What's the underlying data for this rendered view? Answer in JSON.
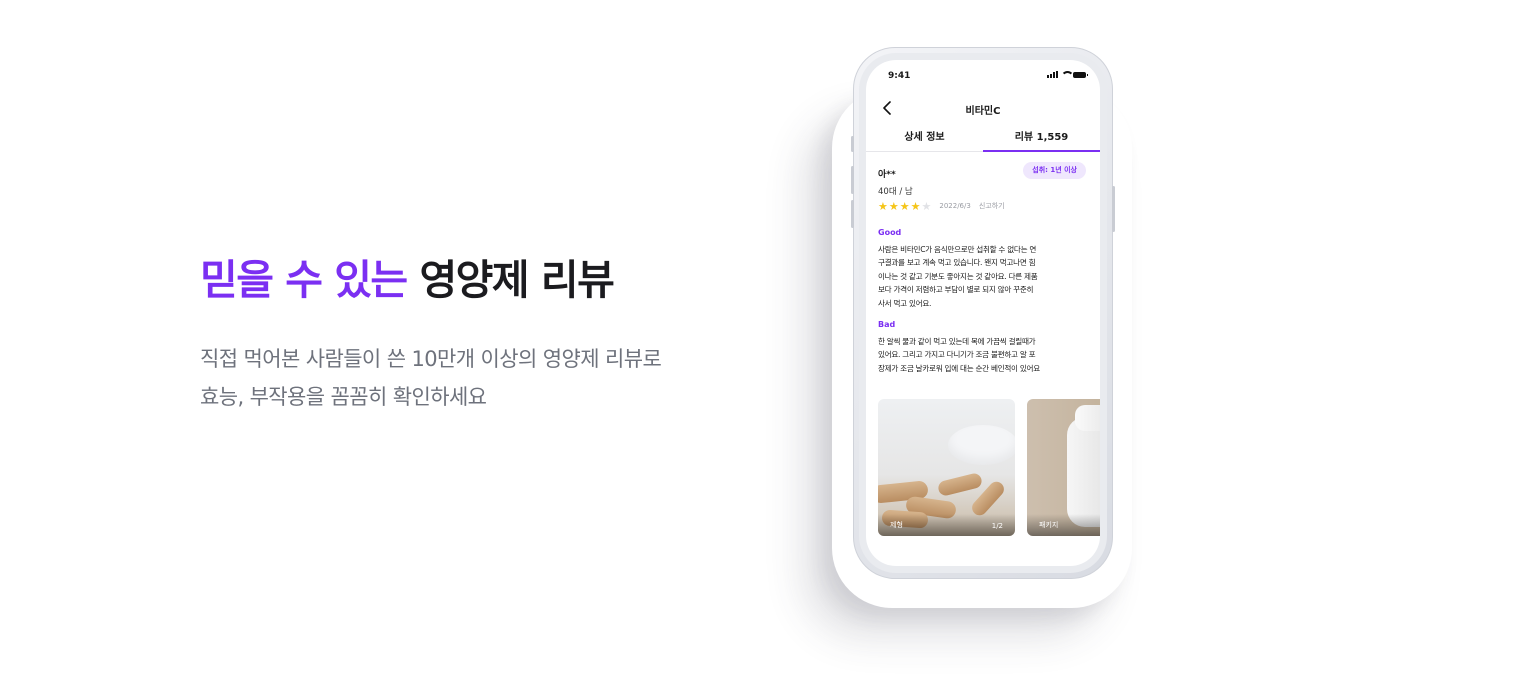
{
  "hero": {
    "title_accent": "믿을 수 있는",
    "title_rest": "영양제 리뷰",
    "subtitle_line1": "직접 먹어본 사람들이 쓴 10만개 이상의 영양제 리뷰로",
    "subtitle_line2": "효능, 부작용을 꼼꼼히 확인하세요"
  },
  "colors": {
    "accent": "#7b2ff2",
    "star": "#f5c518",
    "subtitle": "#6e727c"
  },
  "phone": {
    "status_time": "9:41",
    "nav": {
      "back_icon": "chevron-left-icon",
      "title": "비타민C"
    },
    "tabs": [
      {
        "label": "상세 정보",
        "active": false
      },
      {
        "label": "리뷰 1,559",
        "active": true
      }
    ],
    "review": {
      "reviewer": "아**",
      "badge": "섭취: 1년 이상",
      "meta": "40대 / 남",
      "rating": 4,
      "rating_max": 5,
      "date": "2022/6/3",
      "report": "신고하기",
      "good_label": "Good",
      "good_lines": [
        "사람은 비타민C가 음식만으로만 섭취할 수 없다는 연",
        "구결과를 보고 계속 먹고 있습니다. 왠지 먹고나면 힘",
        "이나는 것 같고 기분도 좋아지는 것 같아요. 다른 제품",
        "보다 가격이 저렴하고 부담이 별로 되지 않아 꾸준히",
        "사서 먹고 있어요."
      ],
      "bad_label": "Bad",
      "bad_lines": [
        "한 알씩 물과 같이 먹고 있는데 목에 가끔씩 걸릴때가",
        "있어요. 그리고 가지고 다니기가 조금 불편하고 알 포",
        "장제가 조금 날카로워 입에 대는 순간 베인적이 있어요"
      ],
      "photos": [
        {
          "caption": "제형",
          "counter": "1/2"
        },
        {
          "caption": "패키지",
          "counter": ""
        }
      ]
    }
  }
}
